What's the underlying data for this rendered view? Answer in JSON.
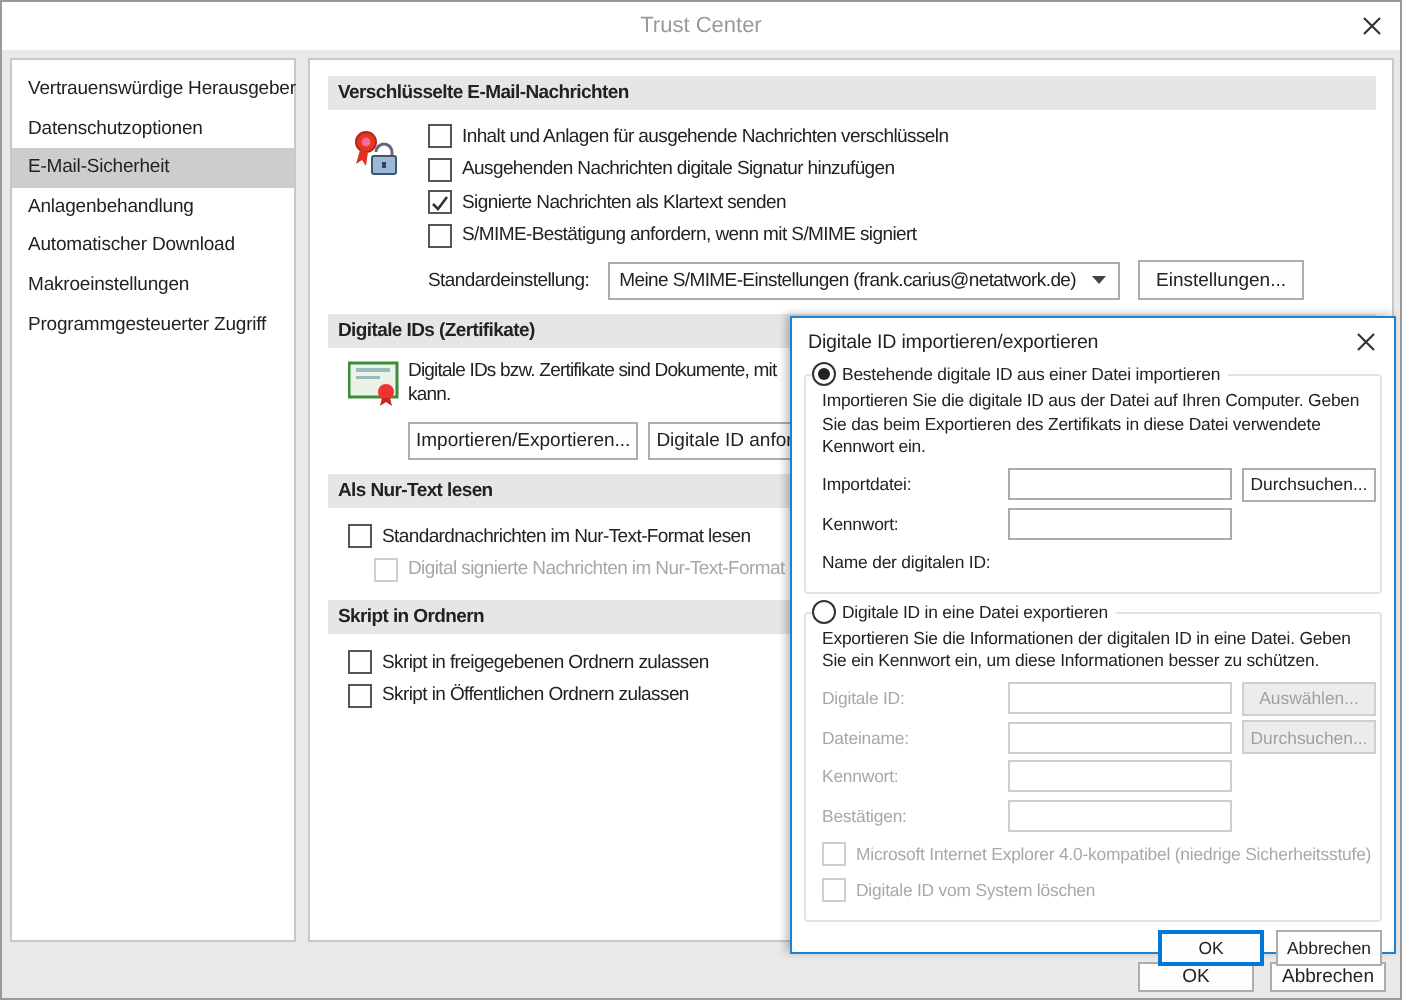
{
  "window": {
    "title": "Trust Center"
  },
  "sidebar": {
    "items": [
      {
        "label": "Vertrauenswürdige Herausgeber",
        "selected": false
      },
      {
        "label": "Datenschutzoptionen",
        "selected": false
      },
      {
        "label": "E-Mail-Sicherheit",
        "selected": true
      },
      {
        "label": "Anlagenbehandlung",
        "selected": false
      },
      {
        "label": "Automatischer Download",
        "selected": false
      },
      {
        "label": "Makroeinstellungen",
        "selected": false
      },
      {
        "label": "Programmgesteuerter Zugriff",
        "selected": false
      }
    ]
  },
  "sections": [
    {
      "kind": "encryption",
      "title": "Verschlüsselte E-Mail-Nachrichten",
      "options": [
        {
          "label": "Inhalt und Anlagen für ausgehende Nachrichten verschlüsseln",
          "checked": false,
          "disabled": false
        },
        {
          "label": "Ausgehenden Nachrichten digitale Signatur hinzufügen",
          "checked": false,
          "disabled": false
        },
        {
          "label": "Signierte Nachrichten als Klartext senden",
          "checked": true,
          "disabled": false
        },
        {
          "label": "S/MIME-Bestätigung anfordern, wenn mit S/MIME signiert",
          "checked": false,
          "disabled": false
        }
      ],
      "default_label": "Standardeinstellung:",
      "default_value": "Meine S/MIME-Einstellungen (frank.carius@netatwork.de)",
      "settings_button": "Einstellungen..."
    },
    {
      "kind": "ids",
      "title": "Digitale IDs (Zertifikate)",
      "description_lines": [
        "Digitale IDs bzw. Zertifikate sind Dokumente, mit",
        "kann."
      ],
      "buttons": [
        "Importieren/Exportieren...",
        "Digitale ID anfor"
      ]
    },
    {
      "kind": "options",
      "title": "Als Nur-Text lesen",
      "options": [
        {
          "label": "Standardnachrichten im Nur-Text-Format lesen",
          "checked": false,
          "disabled": false,
          "children": [
            {
              "label": "Digital signierte Nachrichten im Nur-Text-Format",
              "checked": false,
              "disabled": true
            }
          ]
        }
      ]
    },
    {
      "kind": "options",
      "title": "Skript in Ordnern",
      "options": [
        {
          "label": "Skript in freigegebenen Ordnern zulassen",
          "checked": false,
          "disabled": false
        },
        {
          "label": "Skript in Öffentlichen Ordnern zulassen",
          "checked": false,
          "disabled": false
        }
      ]
    }
  ],
  "footer_buttons": [
    "OK",
    "Abbrechen"
  ],
  "dialog": {
    "title": "Digitale ID importieren/exportieren",
    "groups": [
      {
        "label": "Bestehende digitale ID aus einer Datei importieren",
        "selected": true,
        "description": "Importieren Sie die digitale ID aus der Datei auf Ihren Computer. Geben Sie das beim Exportieren des Zertifikats in diese Datei verwendete Kennwort ein.",
        "fields": [
          {
            "label": "Importdatei:",
            "disabled": false,
            "button": "Durchsuchen..."
          },
          {
            "label": "Kennwort:",
            "disabled": false
          }
        ],
        "note": "Name der digitalen ID:"
      },
      {
        "label": "Digitale ID in eine Datei exportieren",
        "selected": false,
        "description": "Exportieren Sie die Informationen der digitalen ID in eine Datei. Geben Sie ein Kennwort ein, um diese Informationen besser zu schützen.",
        "fields": [
          {
            "label": "Digitale ID:",
            "disabled": true,
            "button": "Auswählen..."
          },
          {
            "label": "Dateiname:",
            "disabled": true,
            "button": "Durchsuchen..."
          },
          {
            "label": "Kennwort:",
            "disabled": true
          },
          {
            "label": "Bestätigen:",
            "disabled": true
          }
        ],
        "options": [
          {
            "label": "Microsoft Internet Explorer 4.0-kompatibel (niedrige Sicherheitsstufe)",
            "checked": false,
            "disabled": true
          },
          {
            "label": "Digitale ID vom System löschen",
            "checked": false,
            "disabled": true
          }
        ]
      }
    ],
    "buttons": [
      {
        "label": "OK",
        "focused": true
      },
      {
        "label": "Abbrechen",
        "focused": false
      }
    ]
  }
}
